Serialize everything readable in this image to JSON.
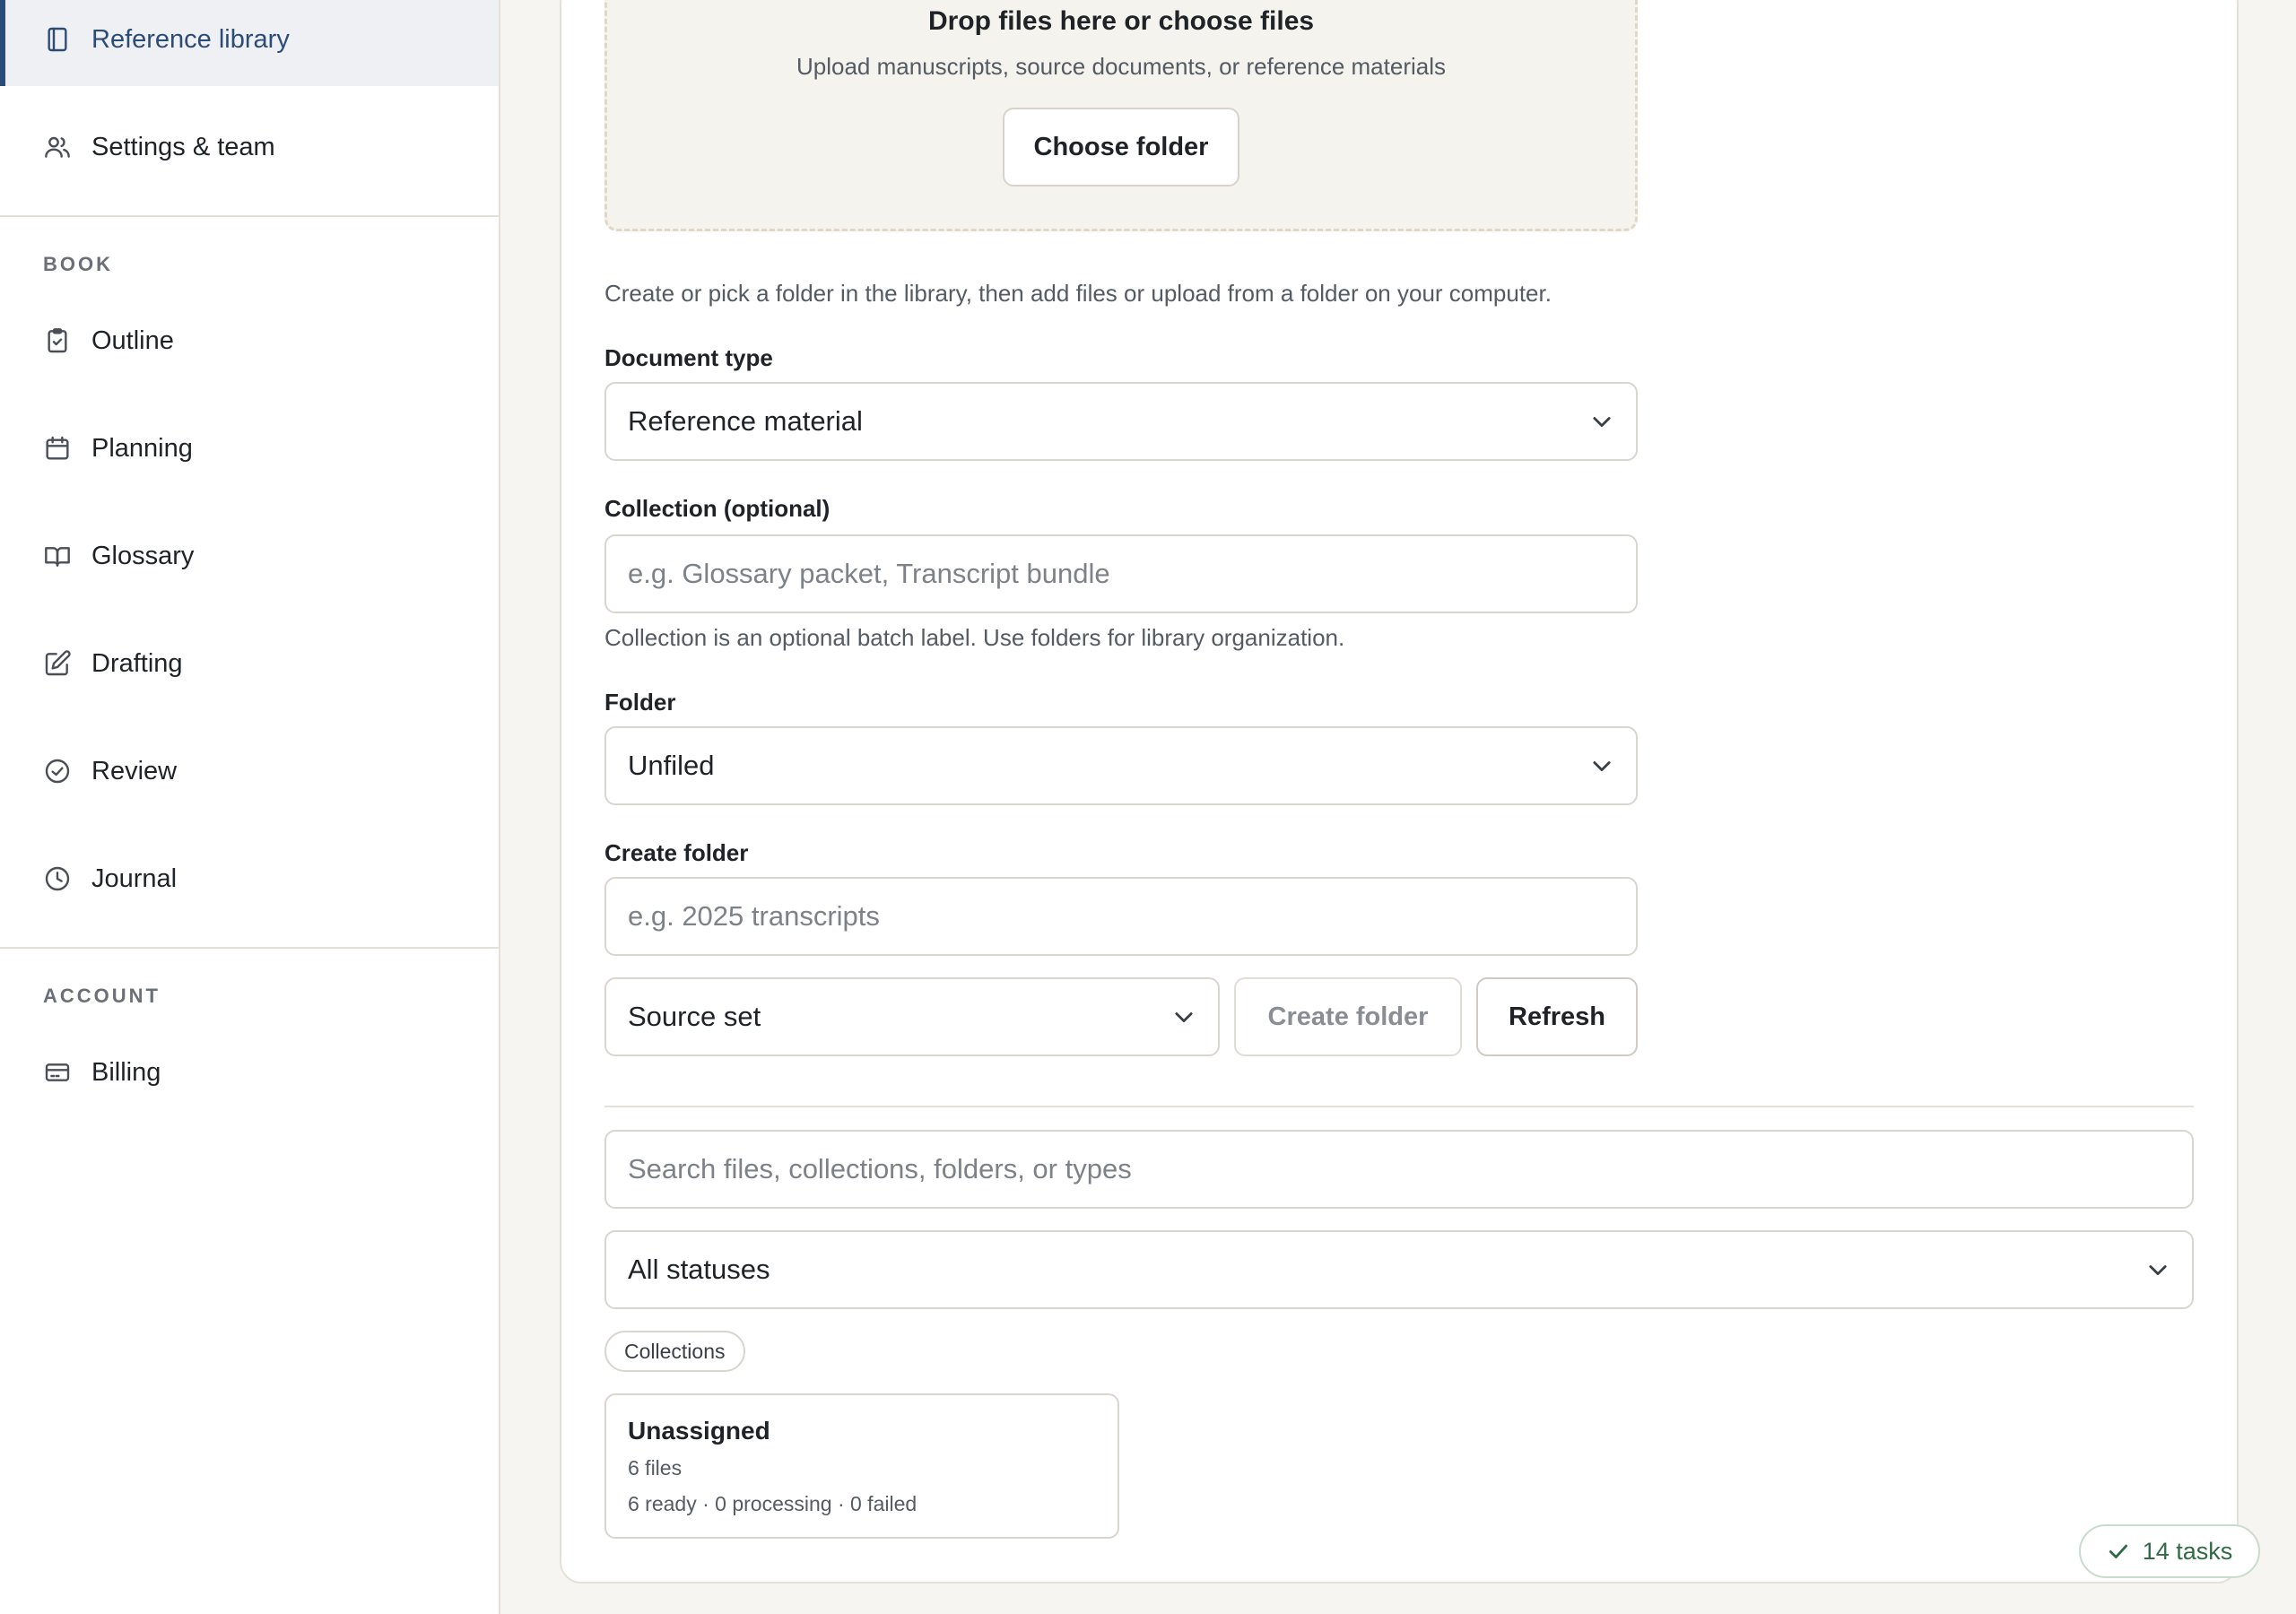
{
  "sidebar": {
    "top_items": [
      {
        "label": "Reference library",
        "icon": "notebook-icon",
        "active": true
      },
      {
        "label": "Settings & team",
        "icon": "users-icon"
      }
    ],
    "book_section": "BOOK",
    "book_items": [
      {
        "label": "Outline",
        "icon": "clipboard-check-icon"
      },
      {
        "label": "Planning",
        "icon": "calendar-icon"
      },
      {
        "label": "Glossary",
        "icon": "book-open-icon"
      },
      {
        "label": "Drafting",
        "icon": "edit-icon"
      },
      {
        "label": "Review",
        "icon": "check-circle-icon"
      },
      {
        "label": "Journal",
        "icon": "clock-icon"
      }
    ],
    "account_section": "ACCOUNT",
    "account_items": [
      {
        "label": "Billing",
        "icon": "credit-card-icon"
      }
    ]
  },
  "upload": {
    "dropzone_title": "Drop files here or choose files",
    "dropzone_subtitle": "Upload manuscripts, source documents, or reference materials",
    "choose_folder_label": "Choose folder",
    "help_text": "Create or pick a folder in the library, then add files or upload from a folder on your computer.",
    "document_type_label": "Document type",
    "document_type_value": "Reference material",
    "collection_label": "Collection (optional)",
    "collection_placeholder": "e.g. Glossary packet, Transcript bundle",
    "collection_help": "Collection is an optional batch label. Use folders for library organization.",
    "folder_label": "Folder",
    "folder_value": "Unfiled",
    "create_folder_label": "Create folder",
    "create_folder_placeholder": "e.g. 2025 transcripts",
    "folder_kind_value": "Source set",
    "create_folder_button": "Create folder",
    "refresh_button": "Refresh"
  },
  "library": {
    "search_placeholder": "Search files, collections, folders, or types",
    "status_filter_value": "All statuses",
    "collections_pill": "Collections",
    "collection_cards": [
      {
        "name": "Unassigned",
        "count": "6 files",
        "status": "6 ready · 0 processing · 0 failed"
      }
    ]
  },
  "tasks_badge": "14 tasks",
  "colors": {
    "accent": "#2c4c78",
    "success": "#2f6b45",
    "background": "#f7f5f1",
    "dropzone_border": "#e2d6c7"
  }
}
